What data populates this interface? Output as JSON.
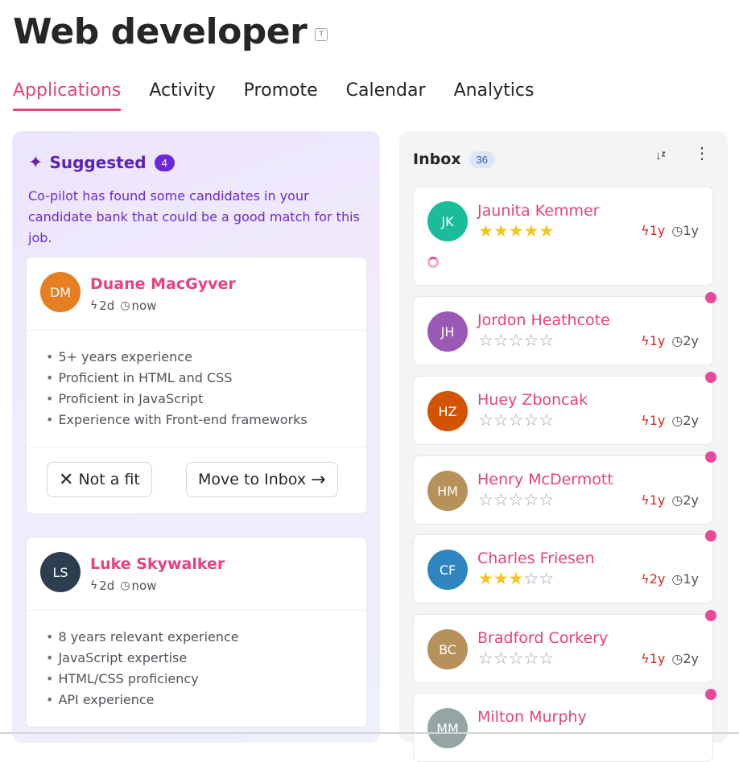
{
  "page": {
    "title": "Web developer",
    "title_icon": "T",
    "tabs": [
      {
        "label": "Applications",
        "active": true
      },
      {
        "label": "Activity",
        "active": false
      },
      {
        "label": "Promote",
        "active": false
      },
      {
        "label": "Calendar",
        "active": false
      },
      {
        "label": "Analytics",
        "active": false
      }
    ]
  },
  "suggested": {
    "title": "Suggested",
    "count": "4",
    "description": "Co-pilot has found some candidates in your candidate bank that could be a good match for this job.",
    "candidates": [
      {
        "initials": "DM",
        "avatar_color": "#e67e22",
        "name": "Duane MacGyver",
        "activity": "2d",
        "time": "now",
        "bullets": [
          "5+ years experience",
          "Proficient in HTML and CSS",
          "Proficient in JavaScript",
          "Experience with Front-end frameworks"
        ],
        "not_fit_label": "Not a fit",
        "move_label": "Move to Inbox"
      },
      {
        "initials": "LS",
        "avatar_color": "#2c3e50",
        "name": "Luke Skywalker",
        "activity": "2d",
        "time": "now",
        "bullets": [
          "8 years relevant experience",
          "JavaScript expertise",
          "HTML/CSS proficiency",
          "API experience"
        ]
      }
    ]
  },
  "inbox": {
    "title": "Inbox",
    "count": "36",
    "items": [
      {
        "initials": "JK",
        "avatar_color": "#1abc9c",
        "name": "Jaunita Kemmer",
        "rating": 5,
        "activity": "1y",
        "time": "1y"
      },
      {
        "initials": "JH",
        "avatar_color": "#9b59b6",
        "name": "Jordon Heathcote",
        "rating": 0,
        "activity": "1y",
        "time": "2y"
      },
      {
        "initials": "HZ",
        "avatar_color": "#d35400",
        "name": "Huey Zboncak",
        "rating": 0,
        "activity": "1y",
        "time": "2y"
      },
      {
        "initials": "HM",
        "avatar_color": "#b7915a",
        "name": "Henry McDermott",
        "rating": 0,
        "activity": "1y",
        "time": "2y"
      },
      {
        "initials": "CF",
        "avatar_color": "#2e86c1",
        "name": "Charles Friesen",
        "rating": 3,
        "activity": "2y",
        "time": "1y"
      },
      {
        "initials": "BC",
        "avatar_color": "#b7915a",
        "name": "Bradford Corkery",
        "rating": 0,
        "activity": "1y",
        "time": "2y"
      },
      {
        "initials": "MM",
        "avatar_color": "#95a5a6",
        "name": "Milton Murphy",
        "rating": 0,
        "activity": "",
        "time": ""
      }
    ]
  },
  "colors": {
    "accent": "#e8417f",
    "suggested_purple": "#5b21b6",
    "star": "#f5c518"
  }
}
